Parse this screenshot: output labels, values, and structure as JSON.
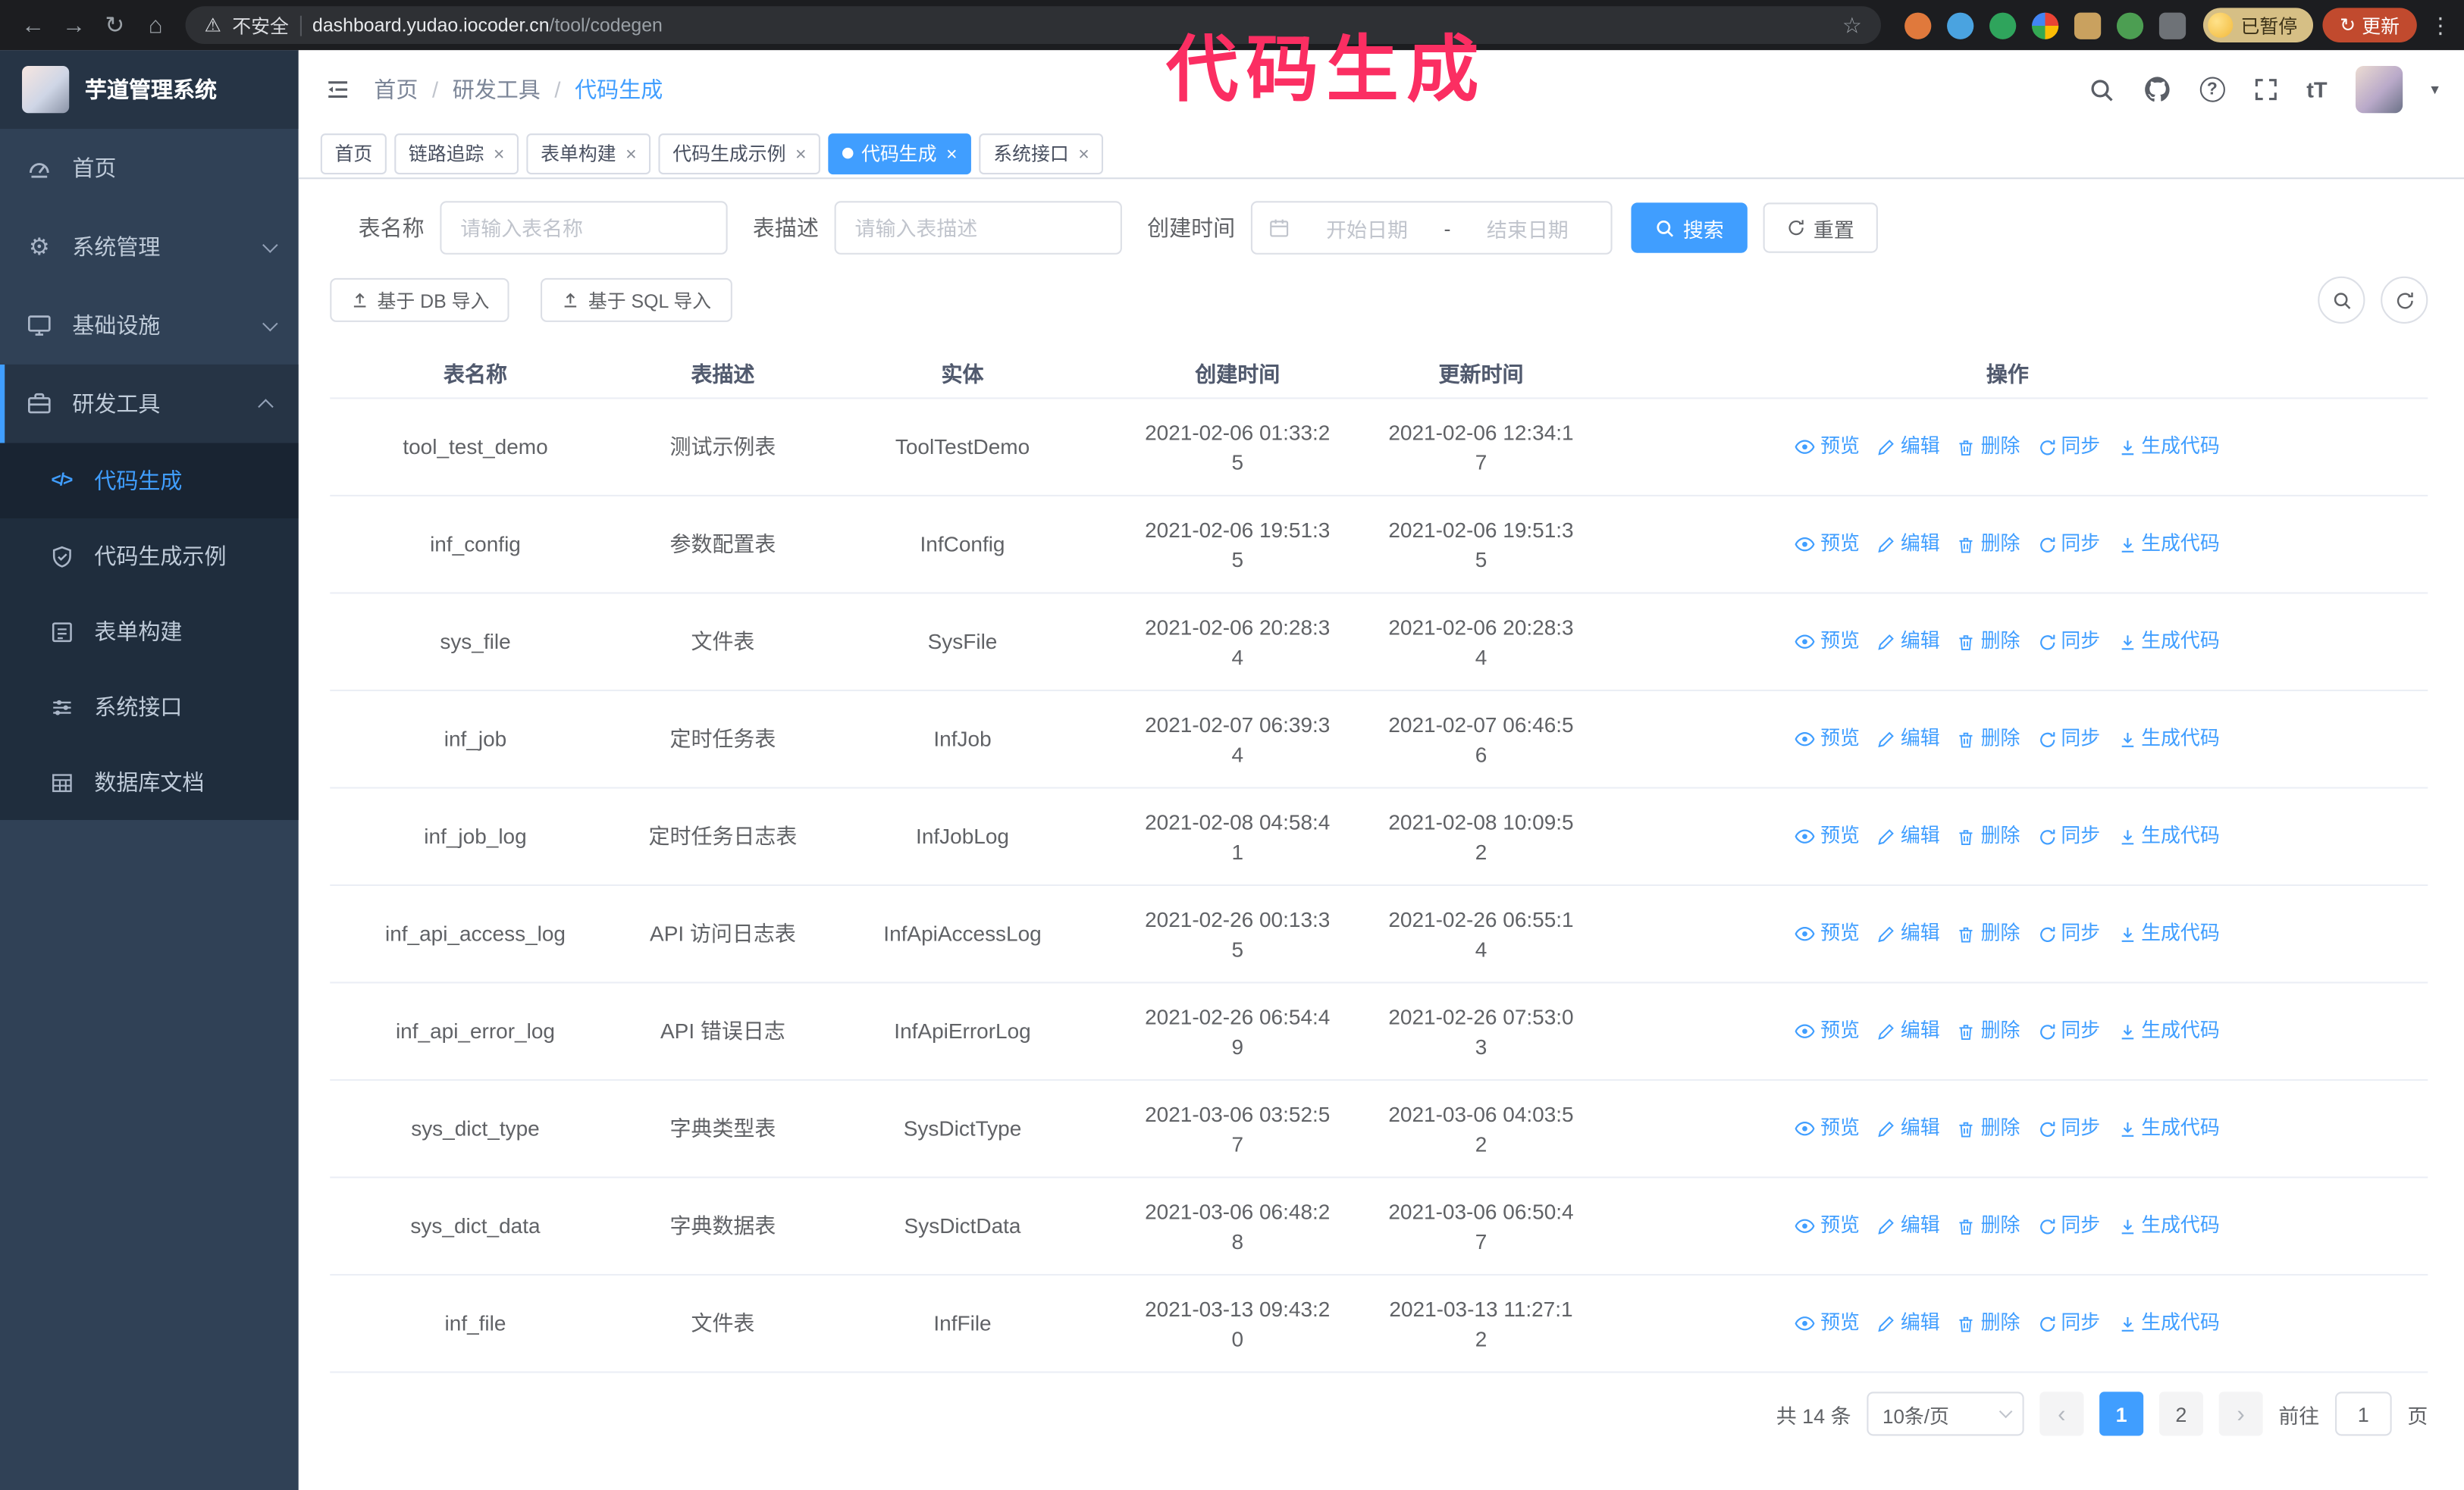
{
  "browser": {
    "security_label": "不安全",
    "url_domain": "dashboard.yudao.iocoder.cn",
    "url_path": "/tool/codegen",
    "paused_badge": "已暂停",
    "update_button": "更新"
  },
  "annotation": {
    "text": "代码生成"
  },
  "colors": {
    "accent": "#409eff",
    "annotation": "#fb2e62"
  },
  "sidebar": {
    "app_title": "芋道管理系统",
    "items": [
      {
        "label": "首页",
        "expandable": false
      },
      {
        "label": "系统管理",
        "expandable": true
      },
      {
        "label": "基础设施",
        "expandable": true
      },
      {
        "label": "研发工具",
        "expandable": true,
        "open": true
      }
    ],
    "sub_items": [
      {
        "label": "代码生成",
        "active": true
      },
      {
        "label": "代码生成示例"
      },
      {
        "label": "表单构建"
      },
      {
        "label": "系统接口"
      },
      {
        "label": "数据库文档"
      }
    ]
  },
  "header": {
    "breadcrumb": [
      "首页",
      "研发工具",
      "代码生成"
    ]
  },
  "tabs": [
    {
      "label": "首页",
      "closable": false
    },
    {
      "label": "链路追踪",
      "closable": true
    },
    {
      "label": "表单构建",
      "closable": true
    },
    {
      "label": "代码生成示例",
      "closable": true
    },
    {
      "label": "代码生成",
      "closable": true,
      "active": true
    },
    {
      "label": "系统接口",
      "closable": true
    }
  ],
  "filters": {
    "table_name_label": "表名称",
    "table_name_placeholder": "请输入表名称",
    "table_desc_label": "表描述",
    "table_desc_placeholder": "请输入表描述",
    "create_time_label": "创建时间",
    "date_start_placeholder": "开始日期",
    "date_separator": "-",
    "date_end_placeholder": "结束日期",
    "search_button": "搜索",
    "reset_button": "重置"
  },
  "toolbar": {
    "import_db_button": "基于 DB 导入",
    "import_sql_button": "基于 SQL 导入"
  },
  "table": {
    "columns": [
      "表名称",
      "表描述",
      "实体",
      "创建时间",
      "更新时间",
      "操作"
    ],
    "actions": [
      "预览",
      "编辑",
      "删除",
      "同步",
      "生成代码"
    ],
    "action_icons": [
      "eye-icon",
      "edit-icon",
      "delete-icon",
      "sync-icon",
      "download-icon"
    ],
    "rows": [
      {
        "name": "tool_test_demo",
        "desc": "测试示例表",
        "entity": "ToolTestDemo",
        "created": "2021-02-06 01:33:25",
        "updated": "2021-02-06 12:34:17"
      },
      {
        "name": "inf_config",
        "desc": "参数配置表",
        "entity": "InfConfig",
        "created": "2021-02-06 19:51:35",
        "updated": "2021-02-06 19:51:35"
      },
      {
        "name": "sys_file",
        "desc": "文件表",
        "entity": "SysFile",
        "created": "2021-02-06 20:28:34",
        "updated": "2021-02-06 20:28:34"
      },
      {
        "name": "inf_job",
        "desc": "定时任务表",
        "entity": "InfJob",
        "created": "2021-02-07 06:39:34",
        "updated": "2021-02-07 06:46:56"
      },
      {
        "name": "inf_job_log",
        "desc": "定时任务日志表",
        "entity": "InfJobLog",
        "created": "2021-02-08 04:58:41",
        "updated": "2021-02-08 10:09:52"
      },
      {
        "name": "inf_api_access_log",
        "desc": "API 访问日志表",
        "entity": "InfApiAccessLog",
        "created": "2021-02-26 00:13:35",
        "updated": "2021-02-26 06:55:14"
      },
      {
        "name": "inf_api_error_log",
        "desc": "API 错误日志",
        "entity": "InfApiErrorLog",
        "created": "2021-02-26 06:54:49",
        "updated": "2021-02-26 07:53:03"
      },
      {
        "name": "sys_dict_type",
        "desc": "字典类型表",
        "entity": "SysDictType",
        "created": "2021-03-06 03:52:57",
        "updated": "2021-03-06 04:03:52"
      },
      {
        "name": "sys_dict_data",
        "desc": "字典数据表",
        "entity": "SysDictData",
        "created": "2021-03-06 06:48:28",
        "updated": "2021-03-06 06:50:47"
      },
      {
        "name": "inf_file",
        "desc": "文件表",
        "entity": "InfFile",
        "created": "2021-03-13 09:43:20",
        "updated": "2021-03-13 11:27:12"
      }
    ]
  },
  "pagination": {
    "total": "共 14 条",
    "page_size": "10条/页",
    "pages": [
      "1",
      "2"
    ],
    "goto_label": "前往",
    "goto_value": "1",
    "page_label": "页"
  },
  "glyphs": {
    "back": "←",
    "forward": "→",
    "reload": "↻",
    "home": "⌂",
    "warning": "⚠",
    "star": "☆",
    "kebab": "⋮",
    "close": "×",
    "prev": "‹",
    "next": "›",
    "caret": "▾",
    "sep": "/",
    "gear": "⚙",
    "code": "</>",
    "text_size": "tT",
    "question": "?"
  }
}
